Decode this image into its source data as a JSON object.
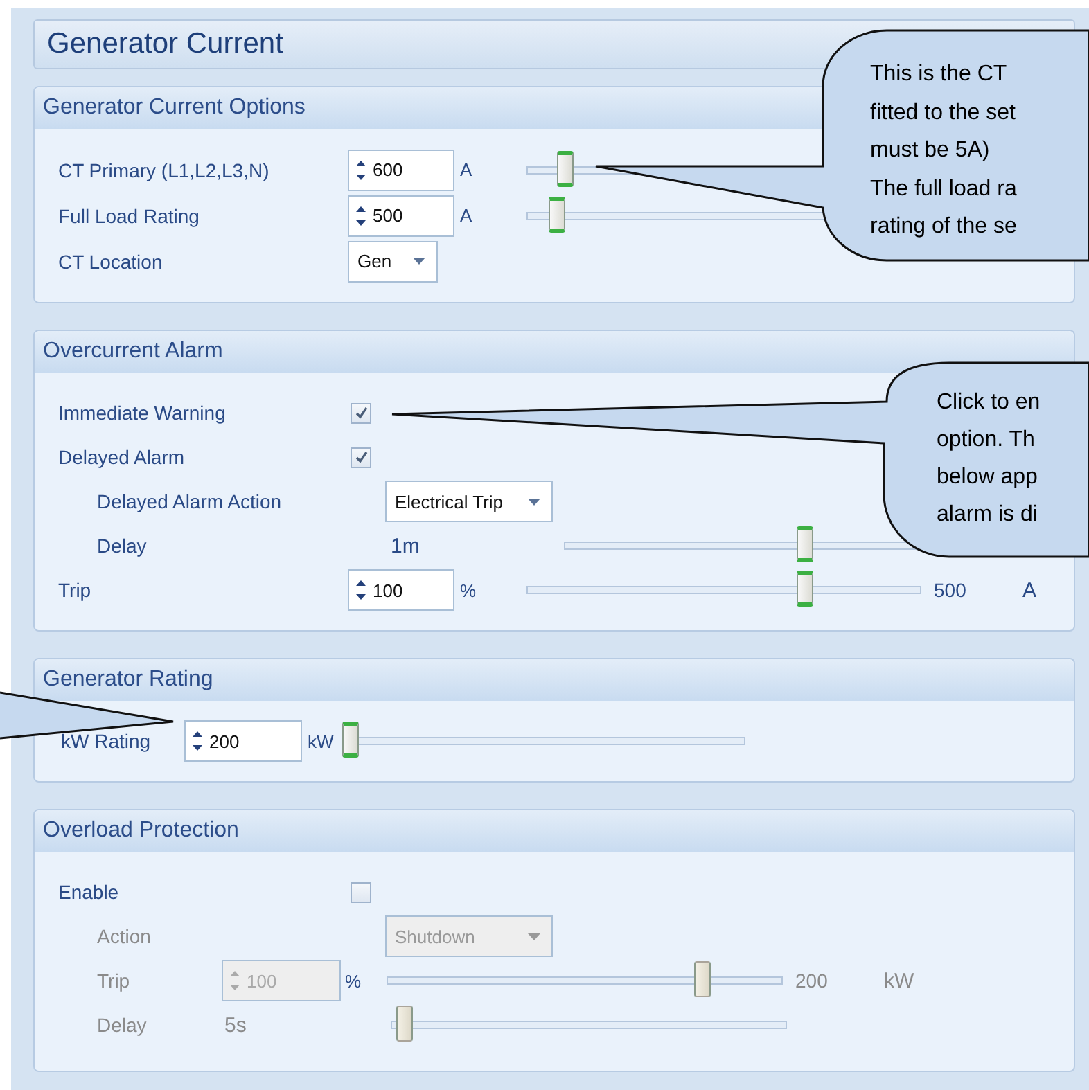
{
  "title": "Generator Current",
  "sections": [
    {
      "title": "Generator Current Options",
      "rows": [
        {
          "kind": "spinner",
          "label": "CT Primary (L1,L2,L3,N)",
          "value": "600",
          "unit": "A",
          "level": 0.1,
          "disabled": false
        },
        {
          "kind": "spinner",
          "label": "Full Load Rating",
          "value": "500",
          "unit": "A",
          "level": 0.08,
          "disabled": false
        },
        {
          "kind": "dropdown",
          "label": "CT Location",
          "value": "Gen",
          "disabled": false
        }
      ]
    },
    {
      "title": "Overcurrent Alarm",
      "rows": [
        {
          "kind": "checkbox",
          "label": "Immediate Warning",
          "checked": true,
          "disabled": false
        },
        {
          "kind": "checkbox",
          "label": "Delayed Alarm",
          "checked": true,
          "disabled": false,
          "children": [
            {
              "kind": "dropdown",
              "label": "Delayed Alarm Action",
              "value": "Electrical Trip",
              "disabled": false
            },
            {
              "kind": "reading",
              "label": "Delay",
              "value": "1m",
              "level": 0.68,
              "disabled": false
            }
          ]
        },
        {
          "kind": "spinner",
          "label": "Trip",
          "value": "100",
          "unit": "%",
          "level": 0.71,
          "max": "500",
          "max_unit": "A",
          "disabled": false
        }
      ]
    },
    {
      "title": "Generator Rating",
      "rows": [
        {
          "kind": "spinner",
          "label": "kW Rating",
          "value": "200",
          "unit": "kW",
          "level": 0.02,
          "disabled": false
        }
      ]
    },
    {
      "title": "Overload Protection",
      "rows": [
        {
          "kind": "checkbox",
          "label": "Enable",
          "checked": false,
          "disabled": false,
          "children": [
            {
              "kind": "dropdown",
              "label": "Action",
              "value": "Shutdown",
              "disabled": true
            },
            {
              "kind": "spinner",
              "label": "Trip",
              "value": "100",
              "unit": "%",
              "level": 0.8,
              "max": "200",
              "max_unit": "kW",
              "disabled": true
            },
            {
              "kind": "reading",
              "label": "Delay",
              "value": "5s",
              "level": 0.04,
              "disabled": true
            }
          ]
        }
      ]
    }
  ],
  "callouts": [
    {
      "text": "This is the CT\nfitted to the set\nmust be 5A)\nThe full load ra\nrating of the se"
    },
    {
      "text": "Click to en\noption. Th\nbelow app\nalarm is di"
    }
  ]
}
